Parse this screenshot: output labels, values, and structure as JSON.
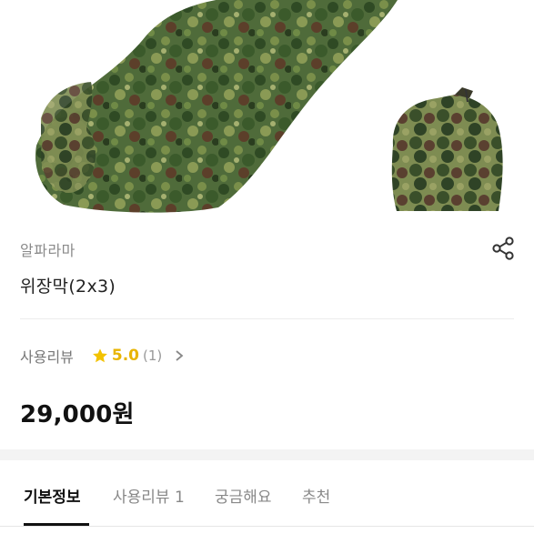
{
  "product": {
    "seller": "알파라마",
    "title": "위장막(2x3)",
    "price": "29,000원",
    "share_icon": "share-icon"
  },
  "review": {
    "label": "사용리뷰",
    "rating": "5.0",
    "count": "(1)",
    "star_color": "#f2c200"
  },
  "tabs": [
    {
      "label": "기본정보",
      "active": true
    },
    {
      "label": "사용리뷰 1",
      "active": false
    },
    {
      "label": "궁금해요",
      "active": false
    },
    {
      "label": "추천",
      "active": false
    }
  ]
}
